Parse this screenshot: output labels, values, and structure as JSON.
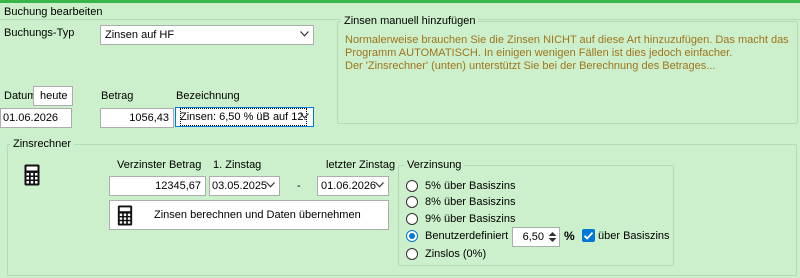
{
  "colors": {
    "background": "#cbf0cb",
    "accent": "#0078d7",
    "note_text": "#a0741e",
    "top_line": "#3ab54a"
  },
  "booking": {
    "title": "Buchung bearbeiten",
    "type_label": "Buchungs-Typ",
    "type_value": "Zinsen auf HF",
    "date_label": "Datum",
    "today_button": "heute",
    "date_value": "01.06.2026",
    "amount_label": "Betrag",
    "amount_value": "1056,43",
    "description_label": "Bezeichnung",
    "description_value": "Zinsen: 6,50 % üB auf 12."
  },
  "manual_interest": {
    "title": "Zinsen manuell hinzufügen",
    "lines": [
      "Normalerweise brauchen Sie die Zinsen NICHT auf diese Art hinzuzufügen. Das macht das",
      "Programm AUTOMATISCH. In einigen wenigen Fällen ist dies jedoch einfacher.",
      "Der 'Zinsrechner' (unten) unterstützt Sie bei der Berechnung des Betrages..."
    ]
  },
  "calculator": {
    "title": "Zinsrechner",
    "icon": "calculator-icon",
    "principal_label": "Verzinster Betrag",
    "principal_value": "12345,67",
    "first_day_label": "1. Zinstag",
    "first_day_value": "03.05.2025",
    "separator": "-",
    "last_day_label": "letzter Zinstag",
    "last_day_value": "01.06.2026",
    "calc_button": "Zinsen berechnen und Daten übernehmen"
  },
  "interest": {
    "title": "Verzinsung",
    "options": [
      "5% über Basiszins",
      "8% über Basiszins",
      "9% über Basiszins",
      "Benutzerdefiniert",
      "Zinslos (0%)"
    ],
    "selected_index": 3,
    "custom_rate": "6,50",
    "percent_sign": "%",
    "over_base_label": "über Basiszins",
    "over_base_checked": true
  }
}
